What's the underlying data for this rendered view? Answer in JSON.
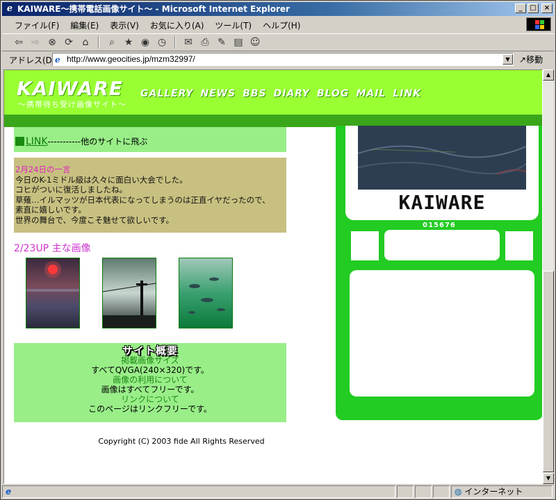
{
  "window": {
    "title": "KAIWARE〜携帯電話画像サイト〜 - Microsoft Internet Explorer",
    "controls": [
      "_",
      "□",
      "×"
    ]
  },
  "menu": {
    "items": [
      "ファイル(F)",
      "編集(E)",
      "表示(V)",
      "お気に入り(A)",
      "ツール(T)",
      "ヘルプ(H)"
    ]
  },
  "address": {
    "label": "アドレス(D)",
    "url": "http://www.geocities.jp/mzm32997/",
    "go_label": "移動"
  },
  "status": {
    "zone": "インターネット"
  },
  "site": {
    "logo": "KAIWARE",
    "logo_sub": "〜携帯待ち受け画像サイト〜",
    "nav": [
      "GALLERY",
      "NEWS",
      "BBS",
      "DIARY",
      "BLOG",
      "MAIL",
      "LINK"
    ],
    "link_row": {
      "link_text": "LINK",
      "desc": "-----------他のサイトに飛ぶ"
    },
    "one_liner": {
      "heading": "2月24日の一言",
      "lines": [
        "今日のK-1ミドル級は久々に面白い大会でした。",
        "コヒがついに復活しましたね。",
        "草薙…イルマッツが日本代表になってしまうのは正直イヤだったので、",
        "素直に嬉しいです。",
        "世界の舞台で、今度こそ魅せて欲しいです。"
      ]
    },
    "update_heading": "2/23UP 主な画像",
    "site_info": {
      "heading": "サイト概要",
      "size_label": "掲載画像サイズ",
      "size_text": "すべてQVGA(240×320)です。",
      "usage_label": "画像の利用について",
      "usage_text": "画像はすべてフリーです。",
      "link_label": "リンクについて",
      "link_text": "このページはリンクフリーです。"
    },
    "copyright": "Copyright (C) 2003 fide All Rights Reserved",
    "right_panel": {
      "brand": "KAIWARE",
      "counter": "015676"
    }
  },
  "colors": {
    "header_green": "#99ff33",
    "strip_green": "#3aa61a",
    "panel_green": "#22cc22",
    "pale_green": "#99ee88",
    "khaki": "#c8c080",
    "magenta": "#cc33cc"
  }
}
